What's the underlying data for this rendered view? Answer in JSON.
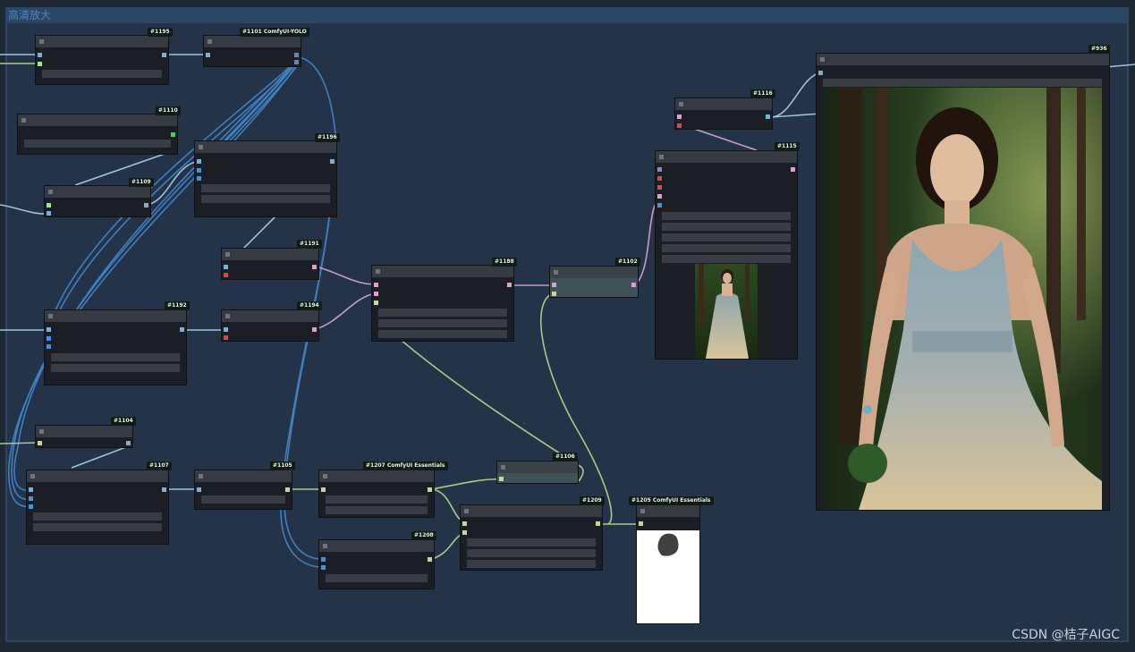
{
  "group": {
    "title": "高清放大"
  },
  "nodes": [
    {
      "id": "n1195",
      "tag": "#1195"
    },
    {
      "id": "n1101",
      "tag": "#1101 ComfyUI-YOLO"
    },
    {
      "id": "n1110",
      "tag": "#1110"
    },
    {
      "id": "n1196",
      "tag": "#1196"
    },
    {
      "id": "n1109",
      "tag": "#1109"
    },
    {
      "id": "n1191",
      "tag": "#1191"
    },
    {
      "id": "n1188",
      "tag": "#1188"
    },
    {
      "id": "n1102",
      "tag": "#1102"
    },
    {
      "id": "n1116",
      "tag": "#1116"
    },
    {
      "id": "n1115",
      "tag": "#1115"
    },
    {
      "id": "n936",
      "tag": "#936"
    },
    {
      "id": "n1192",
      "tag": "#1192"
    },
    {
      "id": "n1194",
      "tag": "#1194"
    },
    {
      "id": "n1104",
      "tag": "#1104"
    },
    {
      "id": "n1107",
      "tag": "#1107"
    },
    {
      "id": "n1105",
      "tag": "#1105"
    },
    {
      "id": "n1207",
      "tag": "#1207 ComfyUI Essentials"
    },
    {
      "id": "n1106",
      "tag": "#1106"
    },
    {
      "id": "n1209",
      "tag": "#1209"
    },
    {
      "id": "n1205",
      "tag": "#1205 ComfyUI Essentials"
    },
    {
      "id": "n1208",
      "tag": "#1208"
    }
  ],
  "watermark": "CSDN @桔子AIGC",
  "colors": {
    "wire_blue": "#3f7fc0",
    "wire_pink": "#c99ac8",
    "wire_green": "#a9c98a",
    "wire_light": "#9fc3d6"
  }
}
